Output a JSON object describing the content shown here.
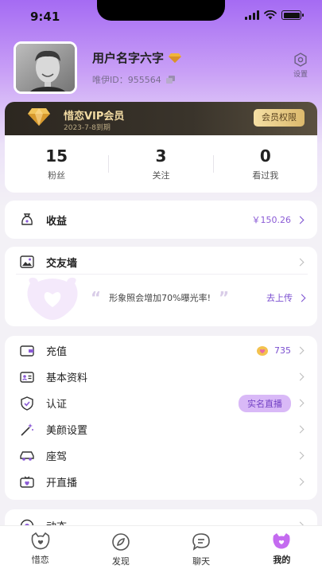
{
  "status_bar": {
    "time": "9:41"
  },
  "profile": {
    "username": "用户名字六字",
    "user_id": "唯伊ID：955564",
    "settings_label": "设置"
  },
  "vip": {
    "title": "惜恋VIP会员",
    "expire": "2023-7-8到期",
    "rights_button": "会员权限"
  },
  "stats": [
    {
      "value": "15",
      "label": "粉丝"
    },
    {
      "value": "3",
      "label": "关注"
    },
    {
      "value": "0",
      "label": "看过我"
    }
  ],
  "earnings": {
    "label": "收益",
    "amount": "￥150.26"
  },
  "friend_wall": {
    "label": "交友墙",
    "tip": "形象照会增加70%曝光率!",
    "upload": "去上传"
  },
  "menu": {
    "recharge": {
      "label": "充值",
      "value": "735"
    },
    "basic_info": {
      "label": "基本资料"
    },
    "verify": {
      "label": "认证",
      "badge": "实名直播"
    },
    "beauty": {
      "label": "美颜设置"
    },
    "vehicle": {
      "label": "座驾"
    },
    "live": {
      "label": "开直播"
    },
    "moments": {
      "label": "动态"
    }
  },
  "tabs": [
    {
      "label": "惜恋"
    },
    {
      "label": "发现"
    },
    {
      "label": "聊天"
    },
    {
      "label": "我的"
    }
  ],
  "colors": {
    "accent": "#8b5bd6",
    "vip_gold": "#f3dca4",
    "badge_bg": "#d9b9f7"
  }
}
